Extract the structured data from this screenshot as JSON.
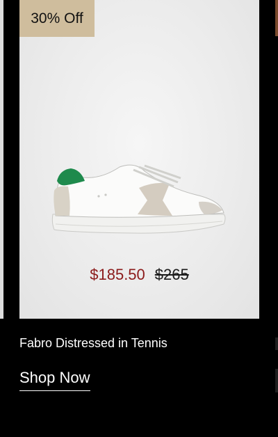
{
  "product": {
    "badge": "30% Off",
    "image_icon": "sneaker-image",
    "sale_price": "$185.50",
    "original_price": "$265",
    "name": "Fabro Distressed in Tennis",
    "cta_label": "Shop Now"
  },
  "colors": {
    "badge_bg": "#cfbd9d",
    "sale_price": "#8b1a1a",
    "heel_tab": "#1e8a4c",
    "background": "#000000"
  }
}
